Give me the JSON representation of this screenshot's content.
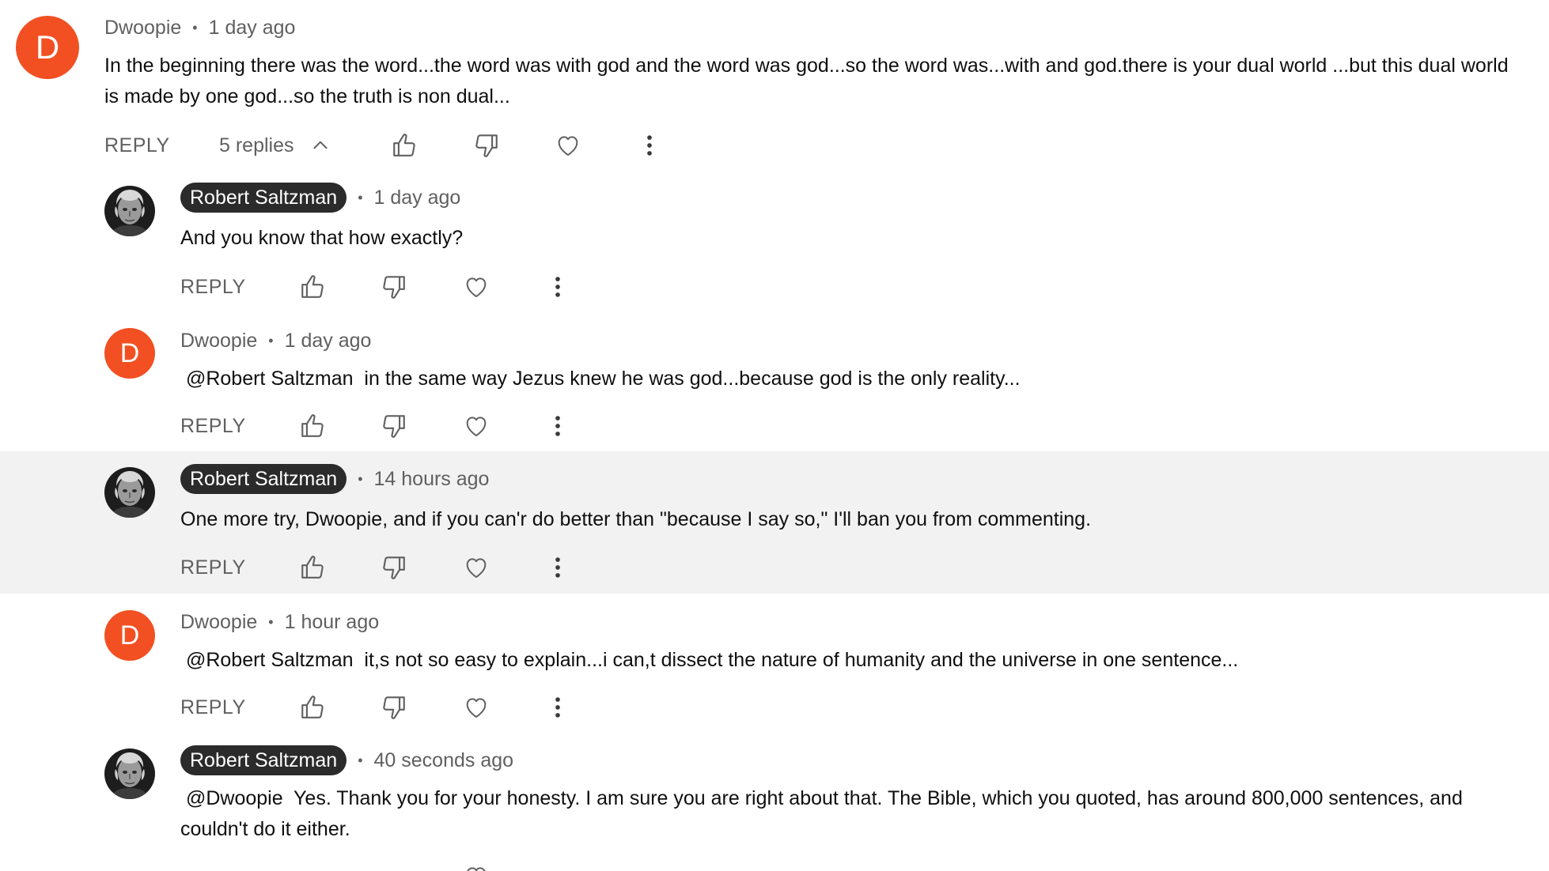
{
  "colors": {
    "avatar_orange": "#f25022",
    "chip_dark": "#2b2b2b",
    "muted_text": "#606060",
    "highlight_bg": "#f2f2f2"
  },
  "icons": {
    "like": "thumbs-up-icon",
    "dislike": "thumbs-down-icon",
    "heart": "heart-icon",
    "more": "more-vert-icon",
    "chevron": "chevron-up-icon"
  },
  "top_comment": {
    "avatar_letter": "D",
    "author": "Dwoopie",
    "time": "1 day ago",
    "text": "In the beginning there was the word...the word was with god and the word was god...so the word was...with and god.there is your dual world ...but this dual world is made by one god...so the truth is non dual...",
    "reply_label": "REPLY",
    "replies_label": "5 replies"
  },
  "replies": [
    {
      "author": "Robert Saltzman",
      "time": "1 day ago",
      "text": "And you know that how exactly?",
      "reply_label": "REPLY"
    },
    {
      "avatar_letter": "D",
      "author": "Dwoopie",
      "time": "1 day ago",
      "text": " @Robert Saltzman  in the same way Jezus knew he was god...because god is the only reality...",
      "reply_label": "REPLY"
    },
    {
      "author": "Robert Saltzman",
      "time": "14 hours ago",
      "text": "One more try, Dwoopie, and if you can'r do better than \"because I say so,\" I'll ban you from commenting.",
      "reply_label": "REPLY"
    },
    {
      "avatar_letter": "D",
      "author": "Dwoopie",
      "time": "1 hour ago",
      "text": " @Robert Saltzman  it,s not so easy to explain...i can,t dissect the nature of humanity and the universe in one sentence...",
      "reply_label": "REPLY"
    },
    {
      "author": "Robert Saltzman",
      "time": "40 seconds ago",
      "text": " @Dwoopie  Yes. Thank you for your honesty. I am sure you are right about that. The Bible, which you quoted, has around 800,000 sentences, and couldn't do it either."
    }
  ]
}
